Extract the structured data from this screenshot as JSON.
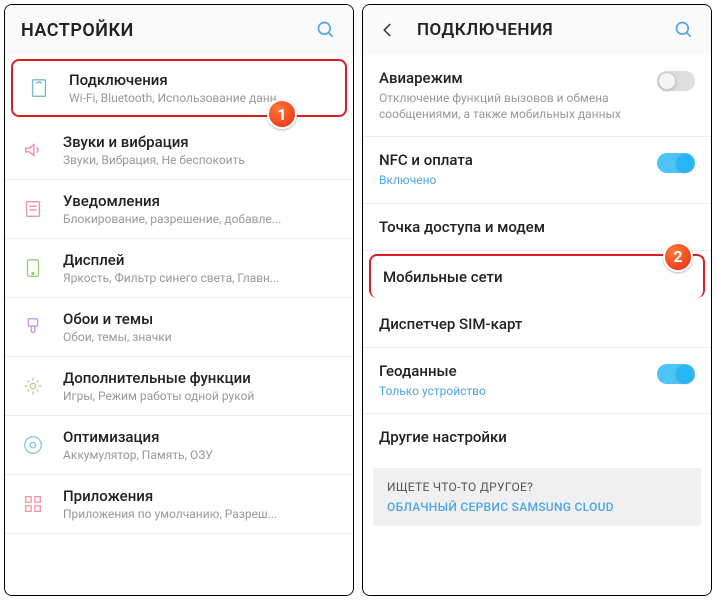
{
  "screen1": {
    "title": "НАСТРОЙКИ",
    "items": [
      {
        "title": "Подключения",
        "sub": "Wi-Fi, Bluetooth, Использование данн..."
      },
      {
        "title": "Звуки и вибрация",
        "sub": "Звуки, Вибрация, Не беспокоить"
      },
      {
        "title": "Уведомления",
        "sub": "Блокирование, разрешение, добавле..."
      },
      {
        "title": "Дисплей",
        "sub": "Яркость, Фильтр синего света, Главн..."
      },
      {
        "title": "Обои и темы",
        "sub": "Обои, темы, значки"
      },
      {
        "title": "Дополнительные функции",
        "sub": "Игры, Режим работы одной рукой"
      },
      {
        "title": "Оптимизация",
        "sub": "Аккумулятор, Память, ОЗУ"
      },
      {
        "title": "Приложения",
        "sub": "Приложения по умолчанию, Разреш..."
      }
    ],
    "badge": "1"
  },
  "screen2": {
    "title": "ПОДКЛЮЧЕНИЯ",
    "items": [
      {
        "title": "Авиарежим",
        "sub": "Отключение функций вызовов и обмена сообщениями, а также мобильных данных"
      },
      {
        "title": "NFC и оплата",
        "sub": "Включено"
      },
      {
        "title": "Точка доступа и модем"
      },
      {
        "title": "Мобильные сети"
      },
      {
        "title": "Диспетчер SIM-карт"
      },
      {
        "title": "Геоданные",
        "sub": "Только устройство"
      },
      {
        "title": "Другие настройки"
      }
    ],
    "badge": "2",
    "footer": {
      "title": "ИЩЕТЕ ЧТО-ТО ДРУГОЕ?",
      "link": "ОБЛАЧНЫЙ СЕРВИС SAMSUNG CLOUD"
    }
  }
}
